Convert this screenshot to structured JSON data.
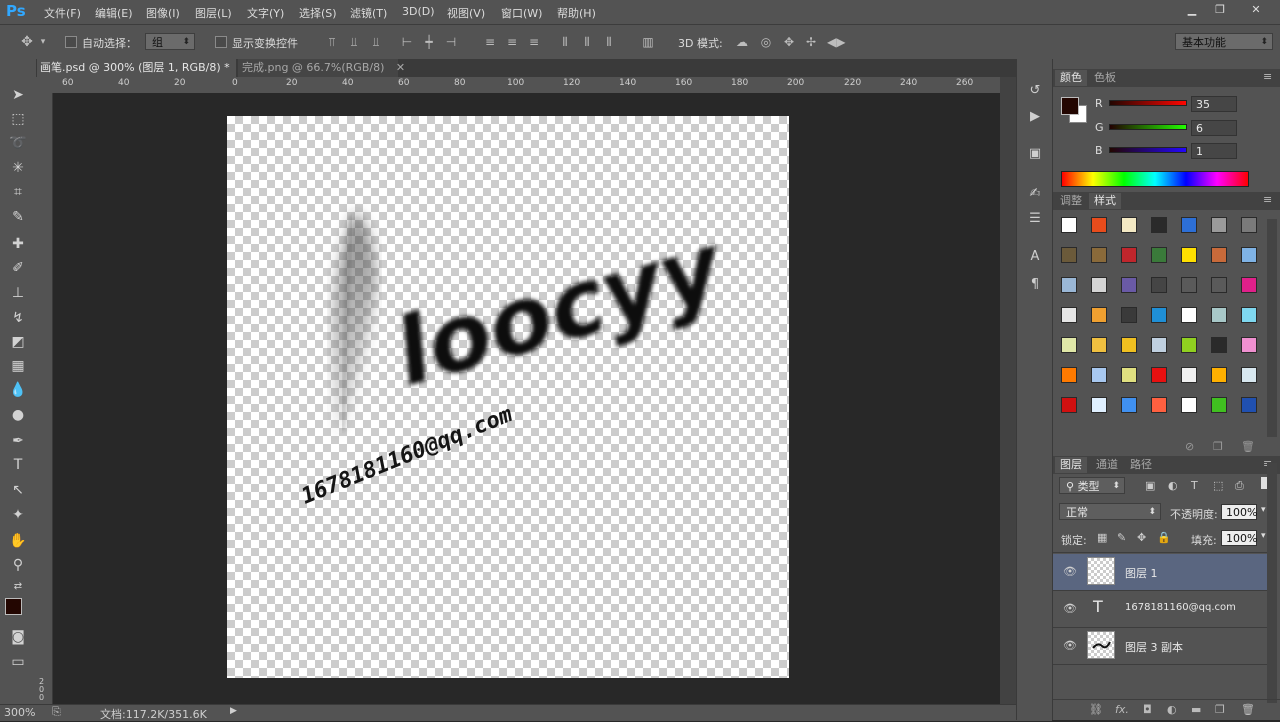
{
  "app": {
    "logo": "Ps"
  },
  "menu": [
    "文件(F)",
    "编辑(E)",
    "图像(I)",
    "图层(L)",
    "文字(Y)",
    "选择(S)",
    "滤镜(T)",
    "3D(D)",
    "视图(V)",
    "窗口(W)",
    "帮助(H)"
  ],
  "window_controls": {
    "minimize": "▁",
    "restore": "❐",
    "close": "✕"
  },
  "options": {
    "auto_select_label": "自动选择：",
    "auto_select_value": "组",
    "show_transform_label": "显示变换控件",
    "mode_3d_label": "3D 模式:",
    "workspace_value": "基本功能"
  },
  "tabs": [
    {
      "label": "画笔.psd @ 300% (图层 1, RGB/8) *",
      "close": "✕"
    },
    {
      "label": "完成.png @ 66.7%(RGB/8)",
      "close": "✕"
    }
  ],
  "ruler_top": [
    "60",
    "40",
    "20",
    "0",
    "20",
    "40",
    "60",
    "80",
    "100",
    "120",
    "140",
    "160",
    "180",
    "200",
    "220",
    "240",
    "260"
  ],
  "ruler_left_label": "200",
  "canvas_text": {
    "signature": "loocyy",
    "email": "1678181160@qq.com"
  },
  "status": {
    "zoom": "300%",
    "doc": "文档:117.2K/351.6K"
  },
  "panels": {
    "color_tabs": [
      "颜色",
      "色板"
    ],
    "rgb": [
      {
        "label": "R",
        "value": "35"
      },
      {
        "label": "G",
        "value": "6"
      },
      {
        "label": "B",
        "value": "1"
      }
    ],
    "fg_color": "#230601",
    "style_tabs": [
      "调整",
      "样式"
    ],
    "layer_tabs": [
      "图层",
      "通道",
      "路径"
    ],
    "filter_label": "类型",
    "blend_mode": "正常",
    "opacity_label": "不透明度:",
    "opacity_value": "100%",
    "lock_label": "锁定:",
    "fill_label": "填充:",
    "fill_value": "100%",
    "layers": [
      {
        "name": "图层 1",
        "kind": "pixel",
        "selected": true
      },
      {
        "name": "1678181160@qq.com",
        "kind": "text",
        "selected": false
      },
      {
        "name": "图层 3 副本",
        "kind": "pixel",
        "selected": false
      }
    ]
  },
  "swatch_rows": [
    [
      "#ffffff",
      "#e84c1c",
      "#f3e9c4",
      "#2a2a2a",
      "#2d6fd6",
      "#9a9a9a",
      "#7a7a7a"
    ],
    [
      "#6b5a3a",
      "#8a6a3a",
      "#c0262c",
      "#3a7a3a",
      "#ffe000",
      "#c86a3a",
      "#7fb3e6"
    ],
    [
      "#9ab7d6",
      "#d4d4d4",
      "#6a5aa6",
      "#454545",
      "#5a5a5a",
      "#5a5a5a",
      "#e0208a"
    ],
    [
      "#e6e6e6",
      "#f0a030",
      "#3a3a3a",
      "#1f8fd6",
      "#ffffff",
      "#a8c8c8",
      "#7fd8f0"
    ],
    [
      "#e0e8a8",
      "#f0c040",
      "#f0c020",
      "#c0d0e0",
      "#90d020",
      "#2a2a2a",
      "#f090d0"
    ],
    [
      "#ff7a00",
      "#a8c8f0",
      "#e0e080",
      "#e81010",
      "#f0f0f0",
      "#ffb000",
      "#d8e8f0"
    ],
    [
      "#d01010",
      "#e0f0ff",
      "#4090f0",
      "#ff6040",
      "#ffffff",
      "#40c020",
      "#2050b0"
    ]
  ]
}
